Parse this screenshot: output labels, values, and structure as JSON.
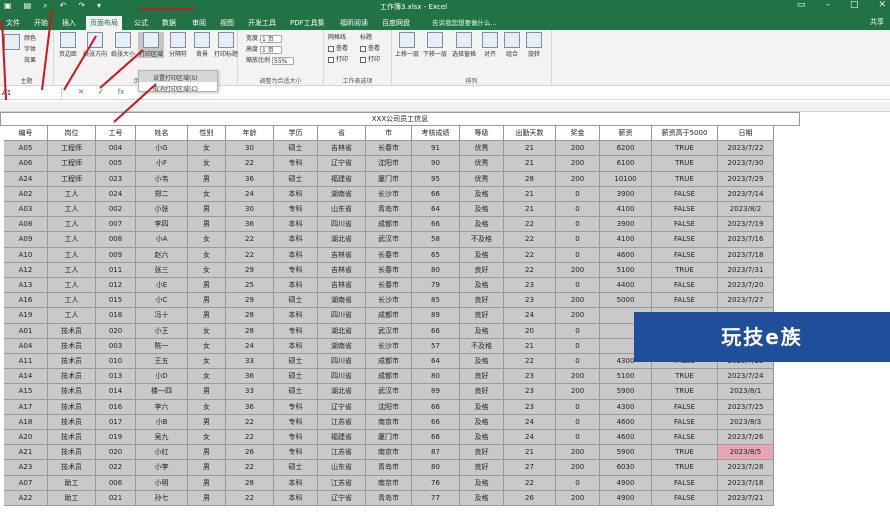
{
  "window": {
    "title": "工作簿3.xlsx - Excel",
    "share": "共享",
    "tell_me": "告诉我您想要做什么..."
  },
  "tabs": [
    "文件",
    "开始",
    "插入",
    "页面布局",
    "公式",
    "数据",
    "审阅",
    "视图",
    "开发工具",
    "PDF工具集",
    "福昕阅读",
    "百度网盘"
  ],
  "active_tab": "页面布局",
  "ribbon": {
    "theme_group": {
      "label": "主题",
      "colors": "颜色",
      "fonts": "字体",
      "effects": "效果"
    },
    "page_setup": {
      "label": "页面设置",
      "buttons": [
        "页边距",
        "纸张方向",
        "纸张大小",
        "打印区域",
        "分隔符",
        "背景",
        "打印标题"
      ]
    },
    "scale_group": {
      "label": "调整为合适大小",
      "width": "宽度",
      "height": "高度",
      "scale": "缩放比例",
      "width_val": "1 页",
      "height_val": "1 页",
      "scale_val": "55%"
    },
    "sheet_options": {
      "label": "工作表选项",
      "gridlines": "网格线",
      "headings": "标题",
      "view": "查看",
      "print": "打印"
    },
    "arrange": {
      "label": "排列",
      "buttons": [
        "上移一层",
        "下移一层",
        "选择窗格",
        "对齐",
        "组合",
        "旋转"
      ]
    }
  },
  "dropdown": {
    "items": [
      "设置打印区域(S)",
      "取消打印区域(C)"
    ]
  },
  "formula_bar": {
    "name_box": "A1",
    "fx": "fx"
  },
  "sheet": {
    "title": "XXX公司员工信息",
    "headers": [
      "编号",
      "岗位",
      "工号",
      "姓名",
      "性别",
      "年龄",
      "学历",
      "省",
      "市",
      "考核成绩",
      "等级",
      "出勤天数",
      "奖金",
      "薪资",
      "薪资高于5000",
      "日期"
    ],
    "rows": [
      [
        "A05",
        "工程师",
        "004",
        "小G",
        "女",
        "30",
        "硕士",
        "吉林省",
        "长春市",
        "91",
        "优秀",
        "21",
        "200",
        "6200",
        "TRUE",
        "2023/7/22"
      ],
      [
        "A06",
        "工程师",
        "005",
        "小F",
        "女",
        "22",
        "专科",
        "辽宁省",
        "沈阳市",
        "90",
        "优秀",
        "21",
        "200",
        "6100",
        "TRUE",
        "2023/7/30"
      ],
      [
        "A24",
        "工程师",
        "023",
        "小韦",
        "男",
        "36",
        "硕士",
        "福建省",
        "厦门市",
        "95",
        "优秀",
        "28",
        "200",
        "10100",
        "TRUE",
        "2023/7/29"
      ],
      [
        "A02",
        "工人",
        "024",
        "郑二",
        "女",
        "24",
        "本科",
        "湖南省",
        "长沙市",
        "66",
        "及格",
        "21",
        "0",
        "3900",
        "FALSE",
        "2023/7/14"
      ],
      [
        "A03",
        "工人",
        "002",
        "小张",
        "男",
        "30",
        "专科",
        "山东省",
        "青岛市",
        "64",
        "及格",
        "21",
        "0",
        "4100",
        "FALSE",
        "2023/8/2"
      ],
      [
        "A08",
        "工人",
        "007",
        "李四",
        "男",
        "36",
        "本科",
        "四川省",
        "成都市",
        "66",
        "及格",
        "22",
        "0",
        "3900",
        "FALSE",
        "2023/7/19"
      ],
      [
        "A09",
        "工人",
        "008",
        "小A",
        "女",
        "22",
        "本科",
        "湖北省",
        "武汉市",
        "58",
        "不及格",
        "22",
        "0",
        "4100",
        "FALSE",
        "2023/7/16"
      ],
      [
        "A10",
        "工人",
        "009",
        "赵六",
        "女",
        "22",
        "本科",
        "吉林省",
        "长春市",
        "65",
        "及格",
        "22",
        "0",
        "4600",
        "FALSE",
        "2023/7/18"
      ],
      [
        "A12",
        "工人",
        "011",
        "张三",
        "女",
        "29",
        "专科",
        "吉林省",
        "长春市",
        "80",
        "良好",
        "22",
        "200",
        "5100",
        "TRUE",
        "2023/7/31"
      ],
      [
        "A13",
        "工人",
        "012",
        "小E",
        "男",
        "25",
        "本科",
        "吉林省",
        "长春市",
        "79",
        "及格",
        "23",
        "0",
        "4400",
        "FALSE",
        "2023/7/20"
      ],
      [
        "A16",
        "工人",
        "015",
        "小C",
        "男",
        "29",
        "硕士",
        "湖南省",
        "长沙市",
        "85",
        "良好",
        "23",
        "200",
        "5000",
        "FALSE",
        "2023/7/27"
      ],
      [
        "A19",
        "工人",
        "018",
        "冯十",
        "男",
        "28",
        "本科",
        "四川省",
        "成都市",
        "89",
        "良好",
        "24",
        "200",
        "",
        "",
        ""
      ],
      [
        "A01",
        "技术员",
        "020",
        "小王",
        "女",
        "28",
        "专科",
        "湖北省",
        "武汉市",
        "66",
        "及格",
        "20",
        "0",
        "",
        "",
        ""
      ],
      [
        "A04",
        "技术员",
        "003",
        "陈一",
        "女",
        "24",
        "本科",
        "湖南省",
        "长沙市",
        "57",
        "不及格",
        "21",
        "0",
        "",
        "",
        ""
      ],
      [
        "A11",
        "技术员",
        "010",
        "王五",
        "女",
        "33",
        "硕士",
        "四川省",
        "成都市",
        "64",
        "及格",
        "22",
        "0",
        "4300",
        "FALSE",
        "2023/7/23"
      ],
      [
        "A14",
        "技术员",
        "013",
        "小D",
        "女",
        "36",
        "硕士",
        "四川省",
        "成都市",
        "80",
        "良好",
        "23",
        "200",
        "5100",
        "TRUE",
        "2023/7/24"
      ],
      [
        "A15",
        "技术员",
        "014",
        "楼一四",
        "男",
        "33",
        "硕士",
        "湖北省",
        "武汉市",
        "89",
        "良好",
        "23",
        "200",
        "5900",
        "TRUE",
        "2023/8/1"
      ],
      [
        "A17",
        "技术员",
        "016",
        "李六",
        "女",
        "36",
        "专科",
        "辽宁省",
        "沈阳市",
        "66",
        "及格",
        "23",
        "0",
        "4300",
        "FALSE",
        "2023/7/25"
      ],
      [
        "A18",
        "技术员",
        "017",
        "小B",
        "男",
        "22",
        "专科",
        "江苏省",
        "南京市",
        "66",
        "及格",
        "24",
        "0",
        "4600",
        "FALSE",
        "2023/8/3"
      ],
      [
        "A20",
        "技术员",
        "019",
        "吴九",
        "女",
        "22",
        "专科",
        "福建省",
        "厦门市",
        "66",
        "及格",
        "24",
        "0",
        "4600",
        "FALSE",
        "2023/7/26"
      ],
      [
        "A21",
        "技术员",
        "020",
        "小红",
        "男",
        "26",
        "专科",
        "江苏省",
        "南京市",
        "87",
        "良好",
        "21",
        "200",
        "5900",
        "TRUE",
        "2023/8/5"
      ],
      [
        "A23",
        "技术员",
        "022",
        "小李",
        "男",
        "22",
        "硕士",
        "山东省",
        "青岛市",
        "80",
        "良好",
        "27",
        "200",
        "6030",
        "TRUE",
        "2023/7/28"
      ],
      [
        "A07",
        "助工",
        "006",
        "小明",
        "男",
        "28",
        "本科",
        "江苏省",
        "南京市",
        "76",
        "及格",
        "22",
        "0",
        "4900",
        "FALSE",
        "2023/7/18"
      ],
      [
        "A22",
        "助工",
        "021",
        "孙七",
        "男",
        "22",
        "本科",
        "辽宁省",
        "青岛市",
        "77",
        "及格",
        "26",
        "200",
        "4900",
        "FALSE",
        "2023/7/21"
      ]
    ]
  },
  "watermark": "玩技e族",
  "colors": {
    "excel_green": "#217346",
    "shade": "#c9c9c9",
    "highlight_cell": "#e7a6b4",
    "watermark_bg": "#1f4f9a",
    "arrow": "#d0141b"
  }
}
